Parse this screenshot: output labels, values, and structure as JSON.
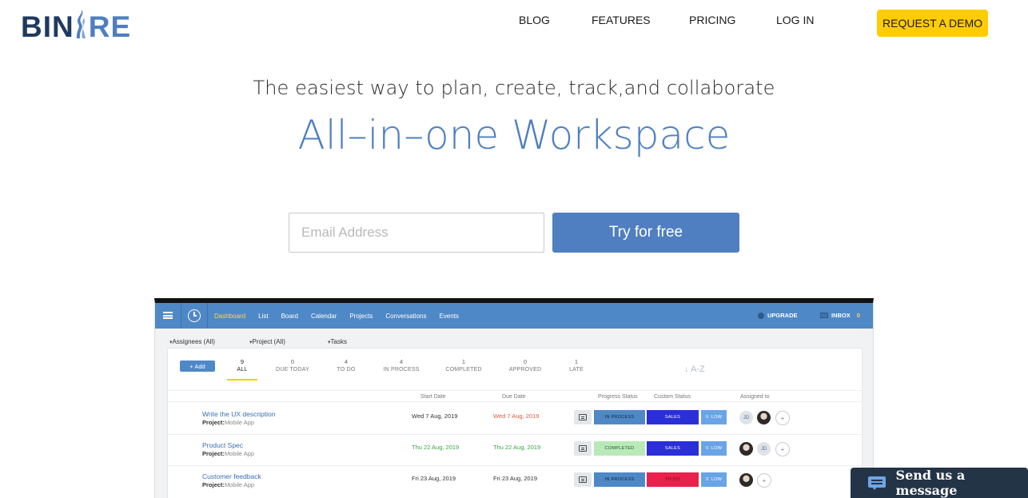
{
  "header": {
    "logo": {
      "text_left": "BIN",
      "text_right": "RE"
    },
    "nav": [
      {
        "label": "BLOG",
        "name": "nav-blog"
      },
      {
        "label": "FEATURES",
        "name": "nav-features"
      },
      {
        "label": "PRICING",
        "name": "nav-pricing"
      },
      {
        "label": "LOG IN",
        "name": "nav-log-in"
      }
    ],
    "demo_button": "REQUEST A DEMO"
  },
  "hero": {
    "tagline": "The easiest way to plan, create, track,and collaborate",
    "headline": "All–in–one Workspace",
    "email_placeholder": "Email Address",
    "try_button": "Try for free"
  },
  "app_preview": {
    "nav": [
      "Dashboard",
      "List",
      "Board",
      "Calendar",
      "Projects",
      "Conversations",
      "Events"
    ],
    "active_nav": "Dashboard",
    "upgrade": "UPGRADE",
    "inbox": "INBOX",
    "inbox_count": "0",
    "filters": [
      "Assignees (All)",
      "Project (All)",
      "Tasks"
    ],
    "add_button": "+ Add",
    "stats": [
      {
        "count": "9",
        "label": "ALL"
      },
      {
        "count": "0",
        "label": "DUE TODAY"
      },
      {
        "count": "4",
        "label": "TO DO"
      },
      {
        "count": "4",
        "label": "IN PROCESS"
      },
      {
        "count": "1",
        "label": "COMPLETED"
      },
      {
        "count": "0",
        "label": "APPROVED"
      },
      {
        "count": "1",
        "label": "LATE"
      }
    ],
    "sort_label": "↓ A-Z",
    "columns": {
      "start": "Start Date",
      "due": "Due Date",
      "progress": "Progress Status",
      "custom": "Custom Status",
      "assigned": "Assigned to"
    },
    "tasks": [
      {
        "name": "Write the UX description",
        "project_label": "Project:",
        "project": "Mobile App",
        "start": "Wed 7 Aug, 2019",
        "due": "Wed 7 Aug, 2019",
        "progress": "IN PROCESS",
        "custom": "SALES",
        "priority": "V. LOW",
        "assignees": [
          "JD",
          "photo",
          "+"
        ]
      },
      {
        "name": "Product Spec",
        "project_label": "Project:",
        "project": "Mobile App",
        "start": "Thu 22 Aug, 2019",
        "due": "Thu 22 Aug, 2019",
        "progress": "COMPLETED",
        "custom": "SALES",
        "priority": "V. LOW",
        "assignees": [
          "photo",
          "JD",
          "+"
        ]
      },
      {
        "name": "Customer feedback",
        "project_label": "Project:",
        "project": "Mobile App",
        "start": "Fri 23 Aug, 2019",
        "due": "Fri 23 Aug, 2019",
        "progress": "IN PROCESS",
        "custom": "TO DO",
        "priority": "V. LOW",
        "assignees": [
          "photo",
          "+"
        ]
      }
    ],
    "colors": {
      "in_process": "#4f88c6",
      "completed": "#b8eab8",
      "sales": "#2b2fd8",
      "todo": "#e8214d",
      "priority": "#6aa4e8",
      "start_late": "#333333",
      "due_late": "#e05a3a",
      "on_time": "#3aa640"
    }
  },
  "chat_widget": {
    "label": "Send us a message"
  }
}
